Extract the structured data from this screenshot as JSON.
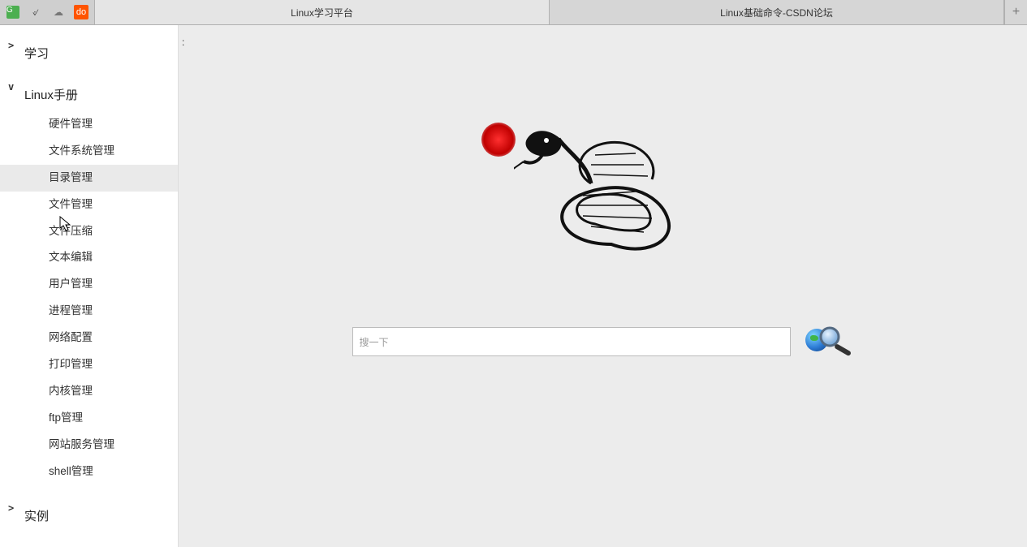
{
  "tabs": {
    "items": [
      {
        "label": "Linux学习平台",
        "active": true
      },
      {
        "label": "Linux基础命令-CSDN论坛",
        "active": false
      }
    ],
    "add_symbol": "+"
  },
  "favicons": [
    {
      "name": "green-block-icon",
      "glyph": "G"
    },
    {
      "name": "bird-icon",
      "glyph": "୰"
    },
    {
      "name": "cloud-icon",
      "glyph": "☁"
    },
    {
      "name": "do-icon",
      "glyph": "do"
    }
  ],
  "sidebar": {
    "sections": [
      {
        "caret": ">",
        "title": "学习",
        "expanded": false,
        "items": []
      },
      {
        "caret": "v",
        "title": "Linux手册",
        "expanded": true,
        "items": [
          {
            "label": "硬件管理",
            "state": ""
          },
          {
            "label": "文件系统管理",
            "state": ""
          },
          {
            "label": "目录管理",
            "state": "active"
          },
          {
            "label": "文件管理",
            "state": ""
          },
          {
            "label": "文件压缩",
            "state": ""
          },
          {
            "label": "文本编辑",
            "state": ""
          },
          {
            "label": "用户管理",
            "state": ""
          },
          {
            "label": "进程管理",
            "state": ""
          },
          {
            "label": "网络配置",
            "state": ""
          },
          {
            "label": "打印管理",
            "state": ""
          },
          {
            "label": "内核管理",
            "state": ""
          },
          {
            "label": "ftp管理",
            "state": ""
          },
          {
            "label": "网站服务管理",
            "state": ""
          },
          {
            "label": "shell管理",
            "state": ""
          }
        ]
      },
      {
        "caret": ">",
        "title": "实例",
        "expanded": false,
        "items": []
      }
    ]
  },
  "main": {
    "colon": ":",
    "search_placeholder": "搜一下"
  }
}
